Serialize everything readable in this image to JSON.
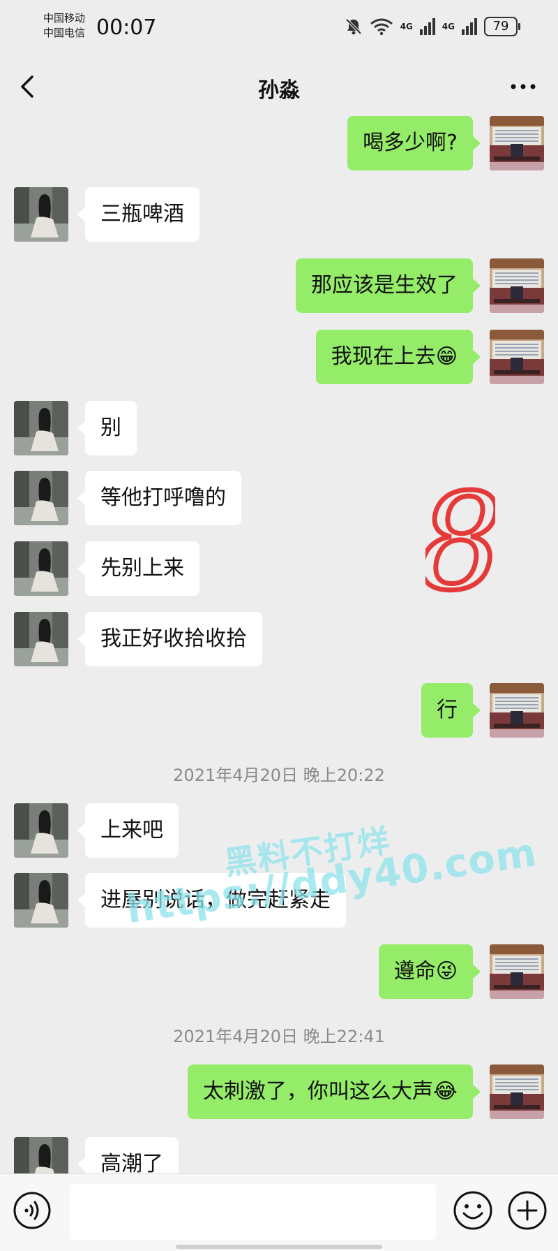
{
  "status_bar": {
    "carrier_1": "中国移动",
    "carrier_2": "中国电信",
    "time": "00:07",
    "network_1": "4G",
    "network_2": "4G",
    "battery": "79"
  },
  "header": {
    "title": "孙淼"
  },
  "messages": [
    {
      "side": "right",
      "text": "喝多少啊?"
    },
    {
      "side": "left",
      "text": "三瓶啤酒"
    },
    {
      "side": "right",
      "text": "那应该是生效了"
    },
    {
      "side": "right",
      "text": "我现在上去😁"
    },
    {
      "side": "left",
      "text": "别"
    },
    {
      "side": "left",
      "text": "等他打呼噜的"
    },
    {
      "side": "left",
      "text": "先别上来"
    },
    {
      "side": "left",
      "text": "我正好收拾收拾"
    },
    {
      "side": "right",
      "text": "行"
    },
    {
      "side": "time",
      "text": "2021年4月20日 晚上20:22"
    },
    {
      "side": "left",
      "text": "上来吧"
    },
    {
      "side": "left",
      "text": "进屋别说话，做完赶紧走"
    },
    {
      "side": "right",
      "text": "遵命😜"
    },
    {
      "side": "time",
      "text": "2021年4月20日 晚上22:41"
    },
    {
      "side": "right",
      "text": "太刺激了，你叫这么大声😂"
    },
    {
      "side": "left",
      "text": "高潮了"
    }
  ],
  "overlay": {
    "mark": "8",
    "watermark_line_1": "黑料不打烊",
    "watermark_line_2": "https://ddy40.com"
  },
  "colors": {
    "self_bubble": "#95ec69",
    "other_bubble": "#ffffff",
    "background": "#ededed"
  },
  "input_bar": {
    "value": "",
    "icons": [
      "voice-icon",
      "emoji-icon",
      "plus-icon"
    ]
  }
}
